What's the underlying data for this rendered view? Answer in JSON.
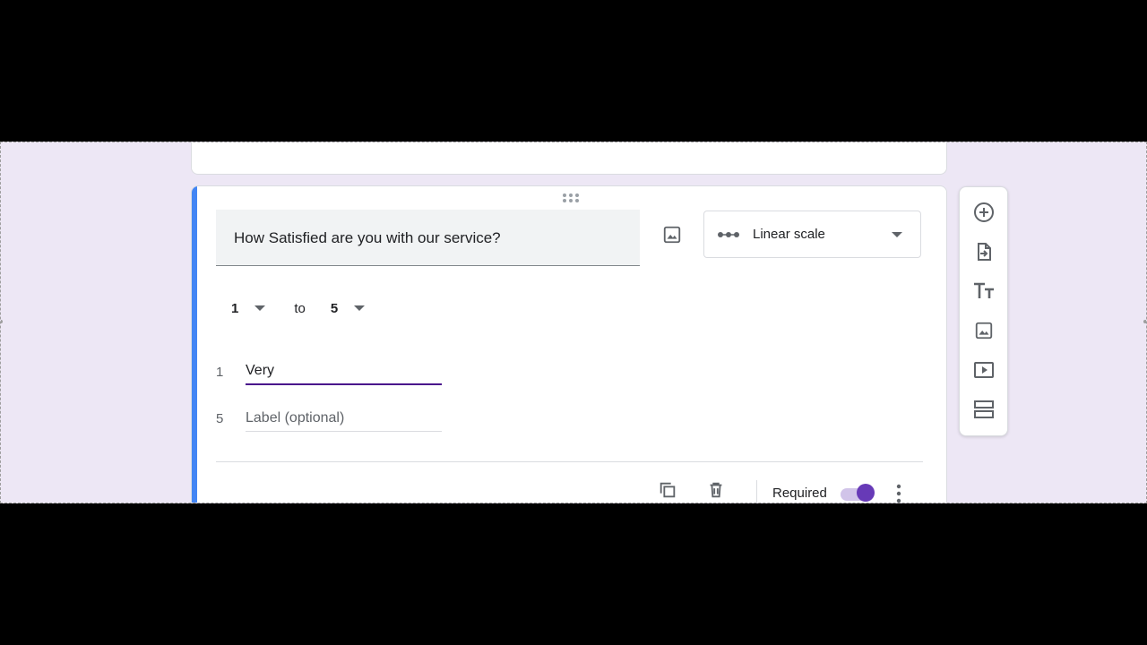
{
  "question": {
    "title": "How Satisfied are you with our service?",
    "type_label": "Linear scale",
    "type_icon": "linear-scale-icon"
  },
  "scale": {
    "min": "1",
    "to_label": "to",
    "max": "5"
  },
  "labels": [
    {
      "index": "1",
      "value": "Very",
      "placeholder": "Label (optional)"
    },
    {
      "index": "5",
      "value": "",
      "placeholder": "Label (optional)"
    }
  ],
  "footer": {
    "required_label": "Required"
  },
  "toolbar": {
    "items": [
      "add-question-icon",
      "import-questions-icon",
      "add-title-icon",
      "add-image-icon",
      "add-video-icon",
      "add-section-icon"
    ]
  },
  "colors": {
    "accent": "#4285f4",
    "active_underline": "#4a148c",
    "toggle": "#673ab7",
    "background": "#ede7f5"
  }
}
